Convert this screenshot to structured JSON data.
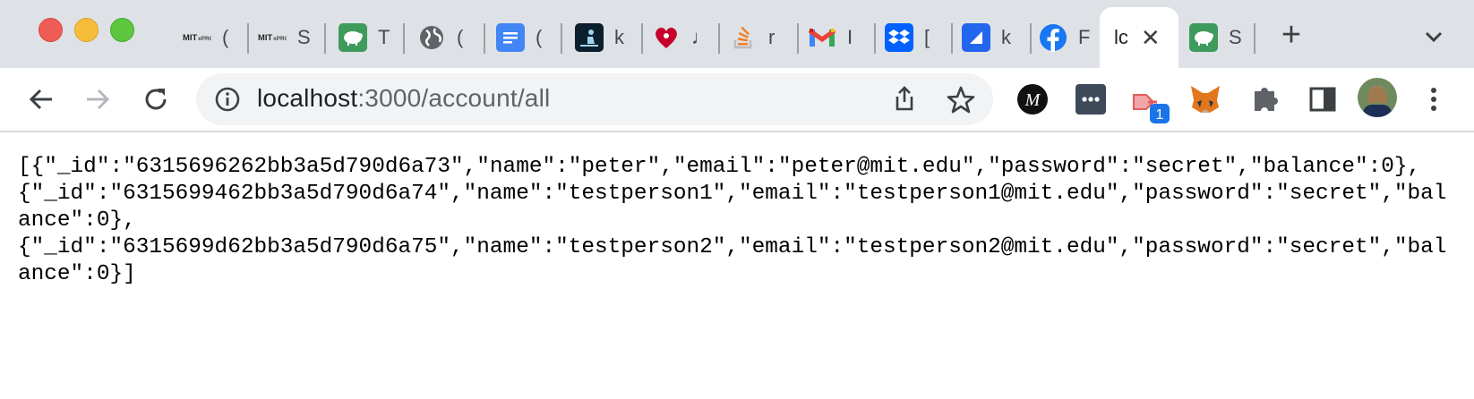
{
  "window": {
    "traffic_lights": [
      "close",
      "minimize",
      "zoom"
    ]
  },
  "tabs": [
    {
      "title": "(",
      "icon": "mit-xpro-icon"
    },
    {
      "title": "S",
      "icon": "mit-xpro-icon"
    },
    {
      "title": "T",
      "icon": "sheep-green-icon"
    },
    {
      "title": "(",
      "icon": "globe-icon"
    },
    {
      "title": "(",
      "icon": "google-docs-icon"
    },
    {
      "title": "k",
      "icon": "kindle-icon"
    },
    {
      "title": "♩",
      "icon": "iheartradio-icon"
    },
    {
      "title": "r",
      "icon": "stackoverflow-icon"
    },
    {
      "title": "I",
      "icon": "gmail-icon"
    },
    {
      "title": "[",
      "icon": "dropbox-icon"
    },
    {
      "title": "k",
      "icon": "kanban-icon"
    },
    {
      "title": "F",
      "icon": "facebook-icon"
    },
    {
      "title": "lc",
      "icon": "",
      "active": true
    },
    {
      "title": "S",
      "icon": "sheep-green-icon"
    }
  ],
  "toolbar": {
    "url_host": "localhost",
    "url_rest": ":3000/account/all",
    "extensions_badge": "1"
  },
  "content": {
    "json_text": "[{\"_id\":\"6315696262bb3a5d790d6a73\",\"name\":\"peter\",\"email\":\"peter@mit.edu\",\"password\":\"secret\",\"balance\":0},\n{\"_id\":\"6315699462bb3a5d790d6a74\",\"name\":\"testperson1\",\"email\":\"testperson1@mit.edu\",\"password\":\"secret\",\"balance\":0},\n{\"_id\":\"6315699d62bb3a5d790d6a75\",\"name\":\"testperson2\",\"email\":\"testperson2@mit.edu\",\"password\":\"secret\",\"balance\":0}]"
  },
  "colors": {
    "tabstrip_bg": "#dee1e6",
    "omnibox_bg": "#f1f3f4",
    "facebook": "#1877f2",
    "dropbox": "#0061ff"
  }
}
